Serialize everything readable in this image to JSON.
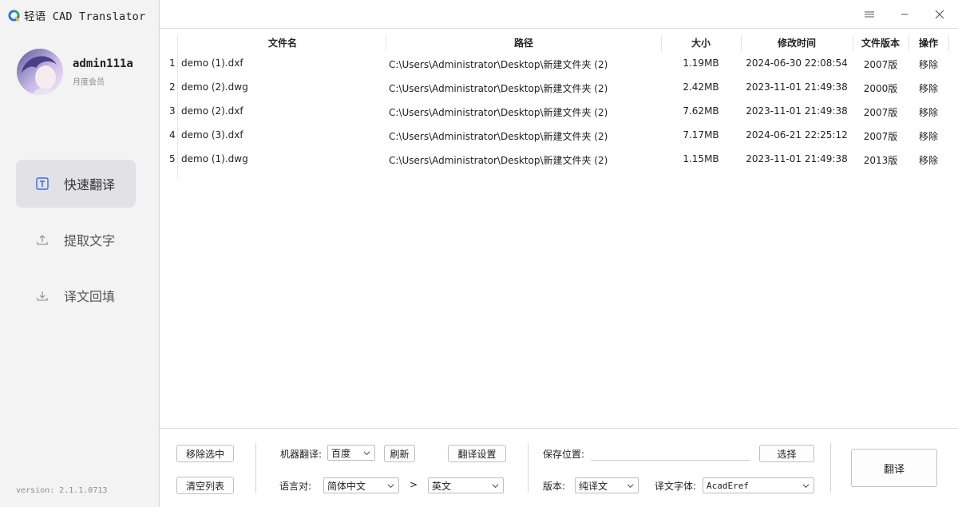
{
  "app": {
    "title": "轻语 CAD Translator",
    "version": "version: 2.1.1.0713"
  },
  "user": {
    "name": "admin111a",
    "level": "月度会员"
  },
  "nav": [
    {
      "label": "快速翻译",
      "icon": "translate-icon",
      "active": true
    },
    {
      "label": "提取文字",
      "icon": "upload-icon",
      "active": false
    },
    {
      "label": "译文回填",
      "icon": "download-icon",
      "active": false
    }
  ],
  "window_controls": [
    "menu-icon",
    "minimize-icon",
    "close-icon"
  ],
  "table": {
    "headers": {
      "name": "文件名",
      "path": "路径",
      "size": "大小",
      "mtime": "修改时间",
      "ver": "文件版本",
      "op": "操作"
    },
    "rows": [
      {
        "n": "1",
        "name": "demo (1).dxf",
        "path": "C:\\Users\\Administrator\\Desktop\\新建文件夹 (2)",
        "size": "1.19MB",
        "mtime": "2024-06-30 22:08:54",
        "ver": "2007版",
        "op": "移除"
      },
      {
        "n": "2",
        "name": "demo (2).dwg",
        "path": "C:\\Users\\Administrator\\Desktop\\新建文件夹 (2)",
        "size": "2.42MB",
        "mtime": "2023-11-01 21:49:38",
        "ver": "2000版",
        "op": "移除"
      },
      {
        "n": "3",
        "name": "demo (2).dxf",
        "path": "C:\\Users\\Administrator\\Desktop\\新建文件夹 (2)",
        "size": "7.62MB",
        "mtime": "2023-11-01 21:49:38",
        "ver": "2007版",
        "op": "移除"
      },
      {
        "n": "4",
        "name": "demo (3).dxf",
        "path": "C:\\Users\\Administrator\\Desktop\\新建文件夹 (2)",
        "size": "7.17MB",
        "mtime": "2024-06-21 22:25:12",
        "ver": "2007版",
        "op": "移除"
      },
      {
        "n": "5",
        "name": "demo (1).dwg",
        "path": "C:\\Users\\Administrator\\Desktop\\新建文件夹 (2)",
        "size": "1.15MB",
        "mtime": "2023-11-01 21:49:38",
        "ver": "2013版",
        "op": "移除"
      }
    ]
  },
  "toolbar": {
    "remove_selected": "移除选中",
    "clear_list": "清空列表",
    "engine_label": "机器翻译:",
    "engine_value": "百度",
    "refresh": "刷新",
    "translate_settings": "翻译设置",
    "lang_label": "语言对:",
    "source_lang": "简体中文",
    "arrow": ">",
    "target_lang": "英文",
    "save_label": "保存位置:",
    "save_value": "",
    "choose": "选择",
    "edition_label": "版本:",
    "edition_value": "纯译文",
    "font_label": "译文字体:",
    "font_value": "AcadEref",
    "translate": "翻译"
  }
}
